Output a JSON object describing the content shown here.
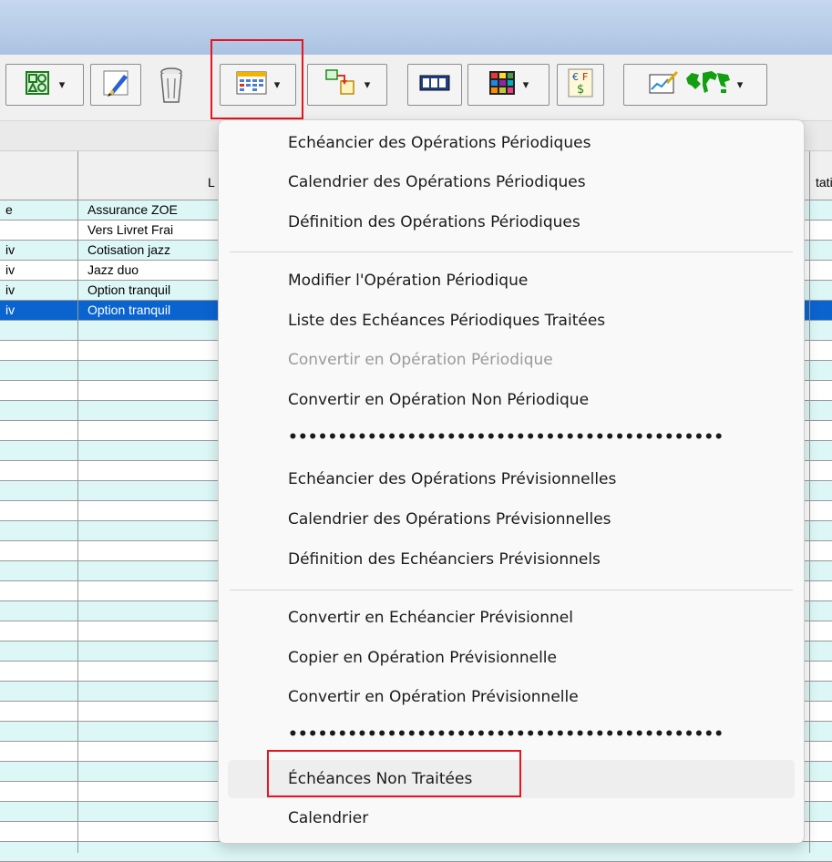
{
  "toolbar": {
    "buttons": [
      {
        "icon": "shapes-icon",
        "has_dropdown": true
      },
      {
        "icon": "pen-edit-icon",
        "has_dropdown": false
      },
      {
        "icon": "trash-icon",
        "has_dropdown": false
      },
      {
        "icon": "calendar-icon",
        "has_dropdown": true,
        "highlighted": true
      },
      {
        "icon": "transfer-icon",
        "has_dropdown": true
      },
      {
        "icon": "counter-icon",
        "has_dropdown": false
      },
      {
        "icon": "color-grid-icon",
        "has_dropdown": true
      },
      {
        "icon": "currency-icon",
        "has_dropdown": false
      },
      {
        "icon": "chart-edit-icon",
        "has_dropdown": false
      },
      {
        "icon": "world-map-icon",
        "has_dropdown": true
      }
    ],
    "dropdown_arrow": "▾"
  },
  "grid": {
    "header_partial_left": "L",
    "header_partial_right": "tati",
    "rows": [
      {
        "c1": "e",
        "c2": "Assurance ZOE"
      },
      {
        "c1": "",
        "c2": "Vers Livret Frai"
      },
      {
        "c1": "iv",
        "c2": "Cotisation jazz"
      },
      {
        "c1": "iv",
        "c2": "Jazz duo"
      },
      {
        "c1": "iv",
        "c2": "Option tranquil"
      },
      {
        "c1": "iv",
        "c2": "Option tranquil",
        "selected": true
      }
    ],
    "colors": {
      "alt_row": "#ddf7f7",
      "selected": "#0a64d0"
    }
  },
  "menu": {
    "items": [
      {
        "label": "Echéancier des Opérations Périodiques"
      },
      {
        "label": "Calendrier des Opérations Périodiques"
      },
      {
        "label": "Définition des Opérations Périodiques"
      },
      {
        "label": "Modifier l'Opération Périodique"
      },
      {
        "label": "Liste des Echéances Périodiques Traitées"
      },
      {
        "label": "Convertir en Opération Périodique",
        "disabled": true
      },
      {
        "label": "Convertir en Opération Non Périodique"
      },
      {
        "label": "Echéancier des Opérations Prévisionnelles"
      },
      {
        "label": "Calendrier des Opérations Prévisionnelles"
      },
      {
        "label": "Définition des Echéanciers Prévisionnels"
      },
      {
        "label": "Convertir en Echéancier Prévisionnel"
      },
      {
        "label": "Copier en Opération Prévisionnelle"
      },
      {
        "label": "Convertir en Opération Prévisionnelle"
      },
      {
        "label": "Échéances Non Traitées",
        "highlighted": true
      },
      {
        "label": "Calendrier"
      }
    ],
    "dots_separator": "••••••••••••••••••••••••••••••••••••••••••••",
    "highlight_color": "#e8141e"
  }
}
